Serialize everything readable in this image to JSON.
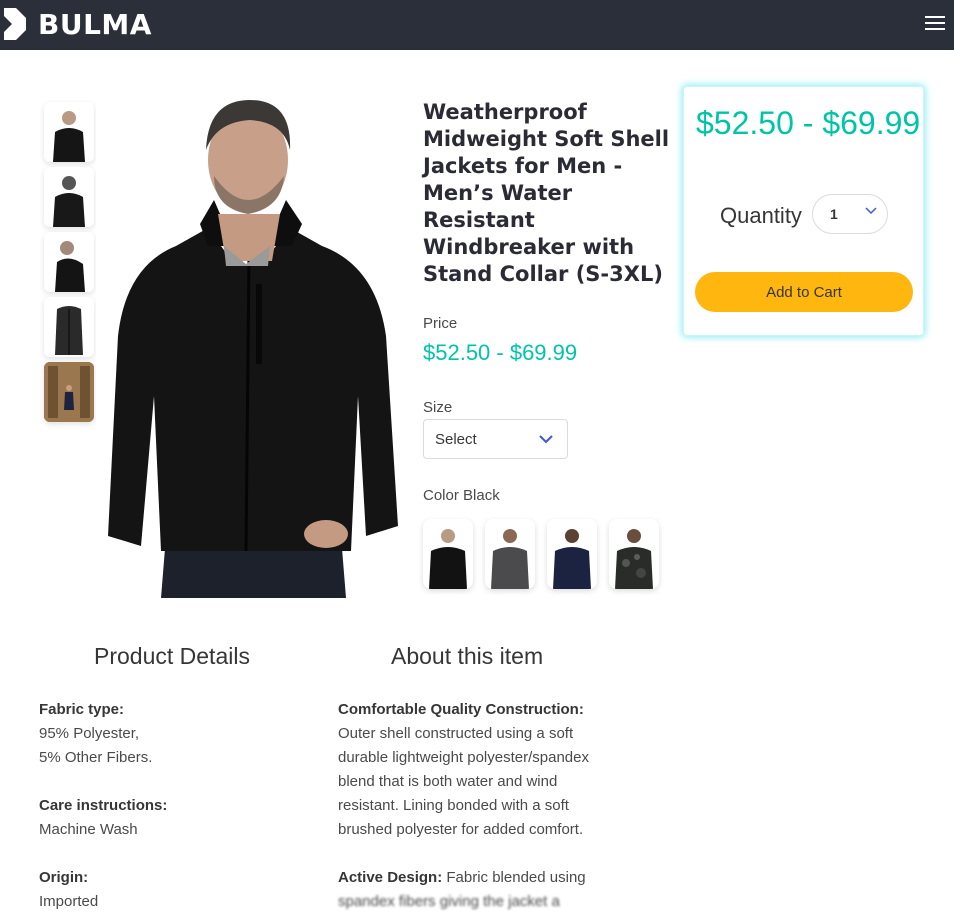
{
  "navbar": {
    "brand": "BULMA",
    "menu_icon": "hamburger-icon"
  },
  "product": {
    "title": "Weatherproof Midweight Soft Shell Jackets for Men - Men’s Water Resistant Windbreaker with Stand Collar (S-3XL)",
    "price_label": "Price",
    "price": "$52.50 - $69.99",
    "size_label": "Size",
    "size_value": "Select",
    "color_label": "Color Black"
  },
  "cart": {
    "price": "$52.50 - $69.99",
    "quantity_label": "Quantity",
    "quantity_value": "1",
    "add_button": "Add to Cart"
  },
  "details": {
    "heading": "Product Details",
    "fabric_label": "Fabric type:",
    "fabric_line1": "95% Polyester,",
    "fabric_line2": "5% Other Fibers.",
    "care_label": "Care instructions:",
    "care_value": "Machine Wash",
    "origin_label": "Origin:",
    "origin_value": "Imported"
  },
  "about": {
    "heading": "About this item",
    "b1_label": "Comfortable Quality Construction:",
    "b1_line1": "Outer shell constructed using a soft",
    "b1_line2": "durable lightweight polyester/spandex",
    "b1_line3": "blend that is both water and wind",
    "b1_line4": "resistant. Lining bonded with a soft",
    "b1_line5": "brushed polyester for added comfort.",
    "b2_label": "Active Design:",
    "b2_line1": " Fabric blended using",
    "b2_line2": "spandex fibers giving the jacket a"
  },
  "colors": {
    "accent": "#00c4a7",
    "button": "#ffb70f",
    "navbar": "#2b2f3a"
  }
}
